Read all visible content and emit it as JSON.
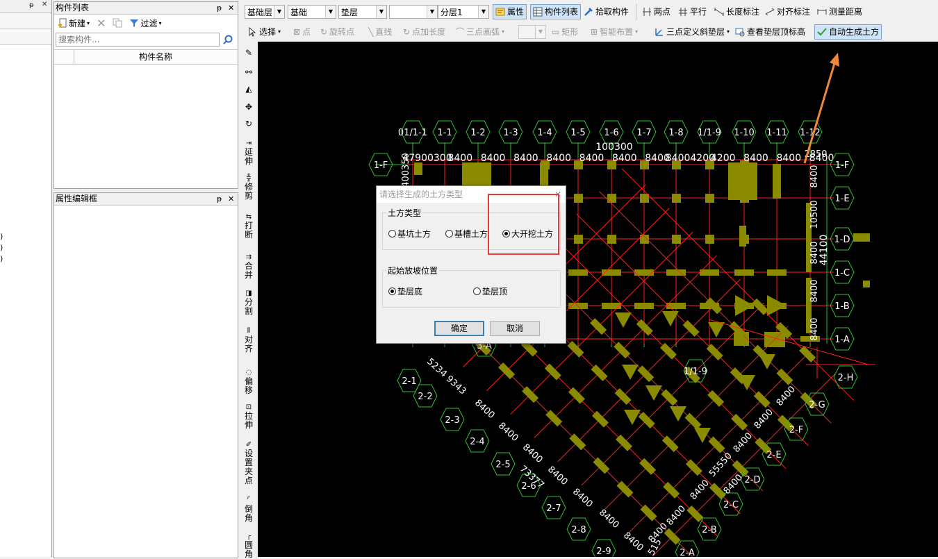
{
  "component_list": {
    "title": "构件列表",
    "new_label": "新建",
    "filter_label": "过滤",
    "search_placeholder": "搜索构件...",
    "column_header": "构件名称"
  },
  "property_panel": {
    "title": "属性编辑框"
  },
  "toolbar": {
    "floor": "基础层",
    "category": "基础",
    "type": "垫层",
    "empty_combo": "",
    "sublayer": "分层1",
    "properties": "属性",
    "component_list": "构件列表",
    "pick_component": "拾取构件",
    "two_points": "两点",
    "parallel": "平行",
    "length_dim": "长度标注",
    "align_dim": "对齐标注",
    "measure": "测量距离",
    "select": "选择",
    "point": "点",
    "rotate_point": "旋转点",
    "line": "直线",
    "point_length": "点加长度",
    "arc3": "三点画弧",
    "rect": "矩形",
    "smart_place": "智能布置",
    "slope_cushion": "三点定义斜垫层",
    "view_cushion_top": "查看垫层顶标高",
    "auto_earthwork": "自动生成土方"
  },
  "vertical_tools": [
    "延伸",
    "修剪",
    "打断",
    "合并",
    "分割",
    "对齐",
    "偏移",
    "拉伸",
    "设置夹点",
    "倒角",
    "圆角"
  ],
  "left_strip_marks": [
    ")",
    ")",
    ")"
  ],
  "dialog": {
    "title": "请选择生成的土方类型",
    "group1": "土方类型",
    "opt_pit": "基坑土方",
    "opt_trench": "基槽土方",
    "opt_open": "大开挖土方",
    "group2": "起始放坡位置",
    "opt_bottom": "垫层底",
    "opt_top": "垫层顶",
    "ok": "确定",
    "cancel": "取消"
  },
  "cad": {
    "axes_top": [
      "01/1-1",
      "1-1",
      "1-2",
      "1-3",
      "1-4",
      "1-5",
      "1-6",
      "1-7",
      "1-8",
      "1/1-9",
      "1-10",
      "1-11",
      "1-12"
    ],
    "axes_right": [
      "1-F",
      "1-E",
      "1-D",
      "1-C",
      "1-B",
      "1-A"
    ],
    "left_axis": "1-F",
    "axes_lower_left": [
      "2-1",
      "2-2",
      "2-3",
      "2-4",
      "2-5",
      "2-6",
      "2-7",
      "2-8",
      "2-9"
    ],
    "axes_lower_right": [
      "2-H",
      "2-G",
      "2-F",
      "2-E",
      "2-D",
      "2-C",
      "2-B",
      "2-A"
    ],
    "axis_3a": "3-A",
    "axis_1_9": "1/1-9",
    "total_top": "100300",
    "dims_top": [
      "47900300",
      "8400",
      "8400",
      "8400",
      "8400",
      "8400",
      "8400",
      "8400",
      "84004200",
      "4200",
      "8400",
      "8400",
      "8400"
    ],
    "dim_2850": "2850",
    "dim_right_total": "44100",
    "dims_right": [
      "8400",
      "10500",
      "8400",
      "8400",
      "8400"
    ],
    "dim_left": "400350",
    "dims_lower_left": [
      "5234 9343",
      "8400",
      "8400",
      "8400",
      "73377",
      "8400",
      "8400",
      "8400",
      "8400"
    ],
    "dims_lower_right": [
      "8400",
      "8400",
      "8400",
      "8400",
      "55550",
      "8400",
      "8400",
      "8400"
    ],
    "dim_bottom": "515"
  },
  "colors": {
    "annotation_arrow": "#f0883a",
    "highlight_box": "#e83a3a",
    "foundation": "#8b8b00",
    "axis_line": "#ff2020",
    "grid_green": "#30c030"
  }
}
